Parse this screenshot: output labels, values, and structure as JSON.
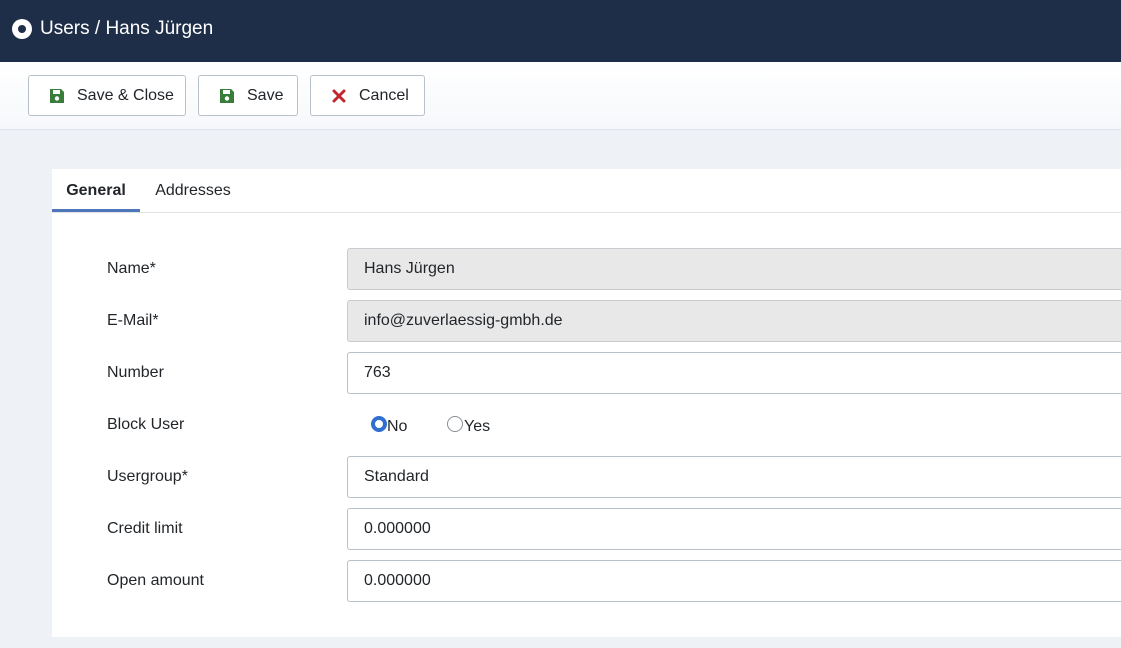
{
  "header": {
    "title": "Users / Hans Jürgen"
  },
  "toolbar": {
    "save_close_label": "Save & Close",
    "save_label": "Save",
    "cancel_label": "Cancel"
  },
  "tabs": [
    {
      "label": "General"
    },
    {
      "label": "Addresses"
    }
  ],
  "form": {
    "name": {
      "label": "Name*",
      "value": "Hans Jürgen"
    },
    "email": {
      "label": "E-Mail*",
      "value": "info@zuverlaessig-gmbh.de"
    },
    "number": {
      "label": "Number",
      "value": "763"
    },
    "block_user": {
      "label": "Block User",
      "options": [
        "No",
        "Yes"
      ],
      "selected": "No"
    },
    "usergroup": {
      "label": "Usergroup*",
      "value": "Standard"
    },
    "credit_limit": {
      "label": "Credit limit",
      "value": "0.000000"
    },
    "open_amount": {
      "label": "Open amount",
      "value": "0.000000"
    }
  },
  "colors": {
    "header_bg": "#1f2e48",
    "save_icon": "#3a7d3a",
    "cancel_icon": "#c0282d",
    "accent": "#2f6fd1"
  }
}
